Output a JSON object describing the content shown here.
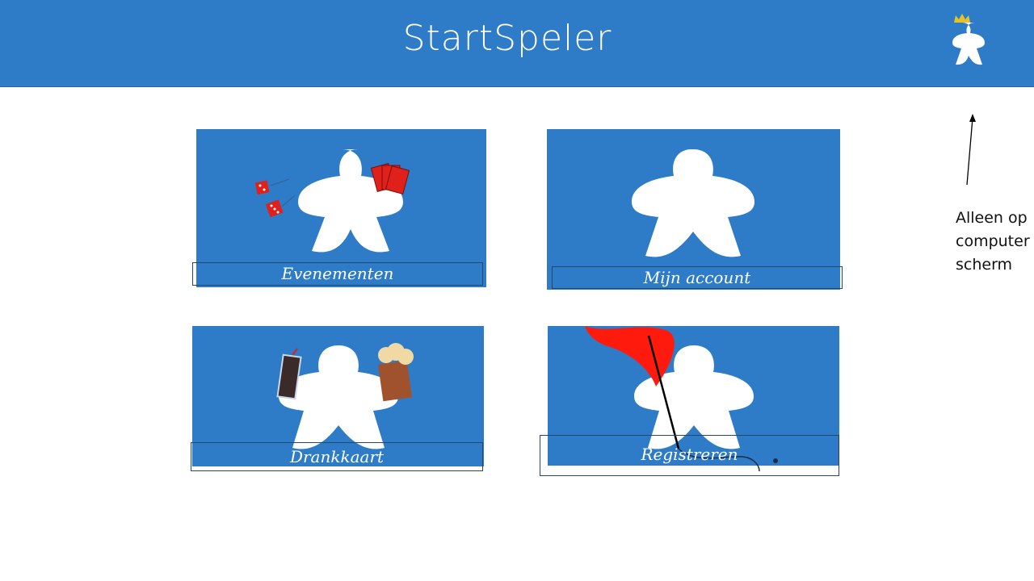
{
  "header": {
    "title": "StartSpeler",
    "profile_icon": "meeple-crown-icon"
  },
  "tiles": [
    {
      "label": "Evenementen",
      "icon": "meeple-dice-cards-icon"
    },
    {
      "label": "Mijn account",
      "icon": "meeple-icon"
    },
    {
      "label": "Drankkaart",
      "icon": "meeple-drinks-icon"
    },
    {
      "label": "Registreren",
      "icon": "meeple-quill-icon"
    }
  ],
  "annotation": {
    "lines": [
      "Alleen op",
      "computer",
      "scherm"
    ]
  },
  "colors": {
    "brand": "#2e7bc7",
    "text_on_brand": "#ffffff"
  }
}
